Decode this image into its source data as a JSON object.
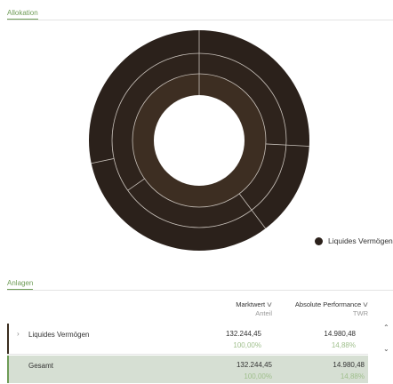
{
  "tabs": {
    "allokation": "Allokation",
    "anlagen": "Anlagen"
  },
  "legend": {
    "items": [
      {
        "label": "Liquides Vermögen",
        "color": "#2b211b"
      }
    ]
  },
  "sunburst": {
    "colors": {
      "outer": "#2b211b",
      "mid": "#2e231c",
      "inner": "#3d2e22",
      "divider": "#c9c2bb"
    }
  },
  "table": {
    "col_marktwert": "Marktwert",
    "col_marktwert_sub": "Anteil",
    "col_perf": "Absolute Performance",
    "col_perf_sub": "TWR",
    "rows": [
      {
        "name": "Liquides Vermögen",
        "marktwert": "132.244,45",
        "anteil": "100,00%",
        "performance": "14.980,48",
        "twr": "14,88%"
      }
    ],
    "total": {
      "name": "Gesamt",
      "marktwert": "132.244,45",
      "anteil": "100,00%",
      "performance": "14.980,48",
      "twr": "14,88%"
    }
  }
}
